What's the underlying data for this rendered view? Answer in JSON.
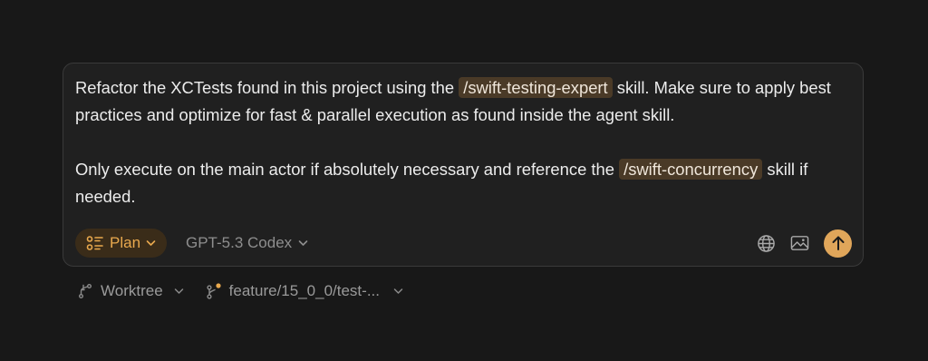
{
  "prompt": {
    "p1_text_a": "Refactor the XCTests found in this project using the ",
    "p1_chip": "/swift-testing-expert",
    "p1_text_b": " skill. Make sure to apply best practices and optimize for fast & parallel execution as found inside the agent skill.",
    "p2_text_a": "Only execute on the main actor if absolutely necessary and reference the ",
    "p2_chip": "/swift-concurrency",
    "p2_text_b": " skill if needed."
  },
  "toolbar": {
    "mode_label": "Plan",
    "model_label": "GPT-5.3 Codex"
  },
  "footer": {
    "worktree_label": "Worktree",
    "branch_label": "feature/15_0_0/test-..."
  },
  "colors": {
    "background": "#181818",
    "composer_bg": "#202020",
    "accent": "#e0a65a",
    "chip_bg": "#4a3a27"
  },
  "icons": [
    "plan-list-icon",
    "chevron-down-icon",
    "globe-icon",
    "image-icon",
    "arrow-up-icon",
    "worktree-icon",
    "branch-icon"
  ]
}
